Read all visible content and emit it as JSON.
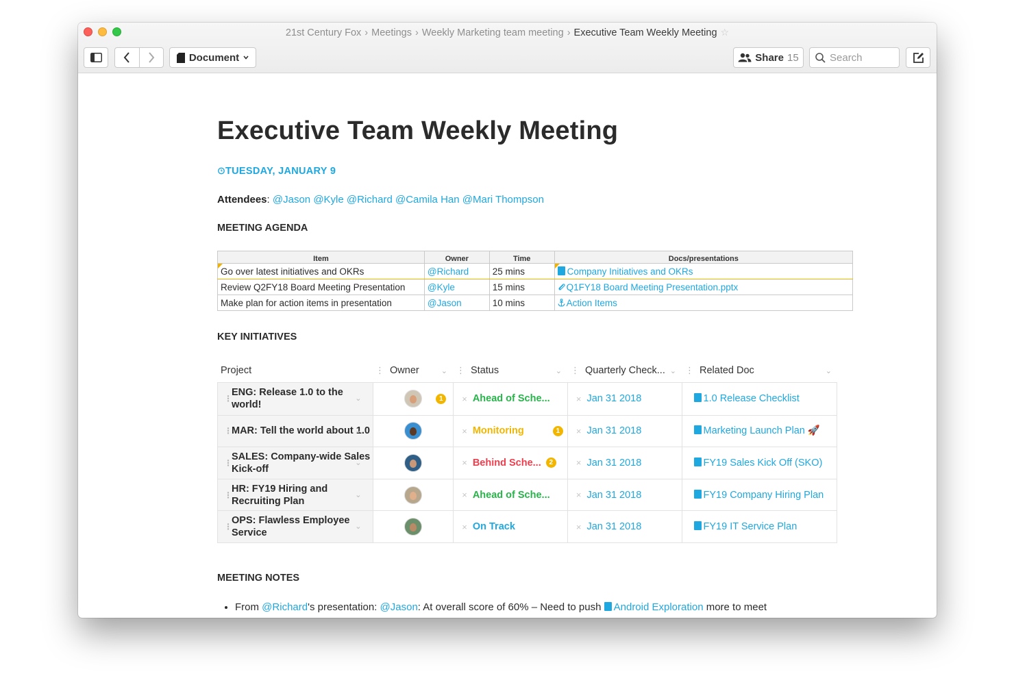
{
  "window": {
    "breadcrumb": [
      "21st Century Fox",
      "Meetings",
      "Weekly Marketing team meeting"
    ],
    "current": "Executive Team Weekly Meeting",
    "star": "☆"
  },
  "toolbar": {
    "doc_label": "Document",
    "share_label": "Share",
    "share_count": "15",
    "search_placeholder": "Search"
  },
  "doc": {
    "title": "Executive Team Weekly Meeting",
    "date": "TUESDAY, JANUARY 9",
    "attendees_label": "Attendees",
    "attendees_colon": ":",
    "attendees": [
      "@Jason",
      "@Kyle",
      "@Richard",
      "@Camila Han",
      "@Mari Thompson"
    ],
    "agenda_heading": "MEETING AGENDA",
    "initiatives_heading": "KEY INITIATIVES",
    "notes_heading": "MEETING NOTES"
  },
  "agenda": {
    "headers": [
      "Item",
      "Owner",
      "Time",
      "Docs/presentations"
    ],
    "rows": [
      {
        "item": "Go over latest initiatives and OKRs",
        "owner": "@Richard",
        "time": "25 mins",
        "doc": "Company Initiatives and OKRs"
      },
      {
        "item": "Review Q2FY18 Board Meeting Presentation",
        "owner": "@Kyle",
        "time": "15 mins",
        "doc": "Q1FY18 Board Meeting Presentation.pptx"
      },
      {
        "item": "Make plan for action items in presentation",
        "owner": "@Jason",
        "time": "10 mins",
        "doc": "Action Items"
      }
    ]
  },
  "initiatives": {
    "headers": [
      "Project",
      "Owner",
      "Status",
      "Quarterly Check...",
      "Related Doc"
    ],
    "rows": [
      {
        "project": "ENG: Release 1.0 to the world!",
        "owner_badge": "1",
        "status": "Ahead of Sche...",
        "status_badge": "",
        "check": "Jan 31 2018",
        "doc": "1.0 Release Checklist"
      },
      {
        "project": "MAR: Tell the world about 1.0",
        "owner_badge": "",
        "status": "Monitoring",
        "status_badge": "1",
        "check": "Jan 31 2018",
        "doc": "Marketing Launch Plan 🚀"
      },
      {
        "project": "SALES: Company-wide Sales Kick-off",
        "owner_badge": "",
        "status": "Behind Sche...",
        "status_badge": "2",
        "check": "Jan 31 2018",
        "doc": "FY19 Sales Kick Off (SKO)"
      },
      {
        "project": "HR: FY19 Hiring and Recruiting Plan",
        "owner_badge": "",
        "status": "Ahead of Sche...",
        "status_badge": "",
        "check": "Jan 31 2018",
        "doc": "FY19 Company Hiring Plan"
      },
      {
        "project": "OPS: Flawless Employee Service",
        "owner_badge": "",
        "status": "On Track",
        "status_badge": "",
        "check": "Jan 31 2018",
        "doc": "FY19 IT Service Plan"
      }
    ]
  },
  "notes": {
    "from": "From",
    "richard": "@Richard",
    "poss": "'s presentation:",
    "jason": "@Jason",
    "text": ": At overall score of 60% – Need to push",
    "link": "Android Exploration",
    "tail": "more to meet"
  },
  "colors": {
    "link": "#1fa8e0",
    "ahead": "#28b44a",
    "monitoring": "#f2b600",
    "behind": "#ee3f4e",
    "on_track": "#1fa8e0"
  },
  "icons": [
    "sidebar-icon",
    "back-icon",
    "forward-icon",
    "document-icon",
    "people-icon",
    "search-icon",
    "compose-icon",
    "alarm-icon"
  ]
}
